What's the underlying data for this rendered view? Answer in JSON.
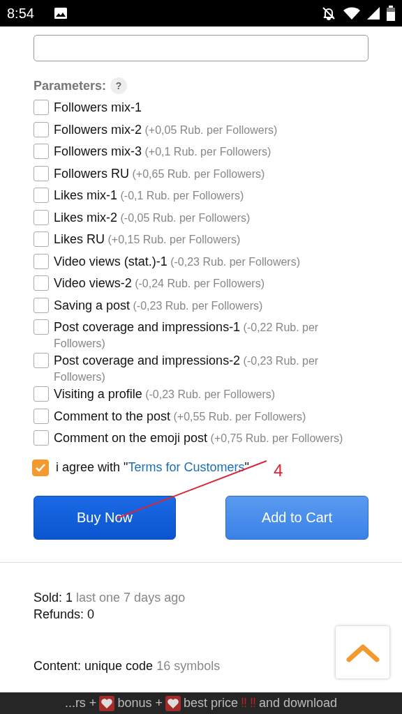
{
  "status_bar": {
    "time": "8:54"
  },
  "parameters": {
    "label": "Parameters:",
    "help": "?",
    "options": [
      {
        "label": "Followers mix-1",
        "checked": false
      },
      {
        "label": "Followers mix-2",
        "price": "(+0,05 Rub. per Followers)",
        "checked": false
      },
      {
        "label": "Followers mix-3",
        "price": "(+0,1 Rub. per Followers)",
        "checked": false
      },
      {
        "label": "Followers RU",
        "price": "(+0,65 Rub. per Followers)",
        "checked": false
      },
      {
        "label": "Likes mix-1",
        "price": "(-0,1 Rub. per Followers)",
        "checked": false
      },
      {
        "label": "Likes mix-2",
        "price": "(-0,05 Rub. per Followers)",
        "checked": false
      },
      {
        "label": "Likes RU",
        "price": "(+0,15 Rub. per Followers)",
        "checked": false
      },
      {
        "label": "Video views (stat.)-1",
        "price": "(-0,23 Rub. per Followers)",
        "checked": false
      },
      {
        "label": "Video views-2",
        "price": "(-0,24 Rub. per Followers)",
        "checked": false
      },
      {
        "label": "Saving a post",
        "price": "(-0,23 Rub. per Followers)",
        "checked": false
      },
      {
        "label": "Post coverage and impressions-1",
        "price": "(-0,22 Rub. per Followers)",
        "checked": false
      },
      {
        "label": "Post coverage and impressions-2",
        "price": "(-0,23 Rub. per Followers)",
        "checked": false
      },
      {
        "label": "Visiting a profile",
        "price": "(-0,23 Rub. per Followers)",
        "checked": false
      },
      {
        "label": "Comment to the post",
        "price": "(+0,55 Rub. per Followers)",
        "checked": false
      },
      {
        "label": "Comment on the emoji post",
        "price": "(+0,75 Rub. per Followers)",
        "checked": false
      }
    ]
  },
  "agree": {
    "checked": true,
    "prefix": "i agree with \"",
    "link": "Terms for Customers",
    "suffix": "\""
  },
  "buttons": [
    {
      "label": "Buy Now",
      "kind": "primary"
    },
    {
      "label": "Add to Cart",
      "kind": "secondary"
    }
  ],
  "stats": {
    "sold_label": "Sold: 1",
    "sold_note": "last one 7 days ago",
    "refunds": "Refunds: 0",
    "content_label": "Content: unique code",
    "content_note": "16 symbols"
  },
  "annotation": {
    "text": "4"
  },
  "banner": [
    {
      "kind": "text",
      "text": "...rs +"
    },
    {
      "kind": "heart"
    },
    {
      "kind": "text",
      "text": "bonus +"
    },
    {
      "kind": "heart"
    },
    {
      "kind": "text",
      "text": "best price"
    },
    {
      "kind": "mark",
      "text": "‼"
    },
    {
      "kind": "mark",
      "text": "‼"
    },
    {
      "kind": "text",
      "text": "and download"
    }
  ]
}
